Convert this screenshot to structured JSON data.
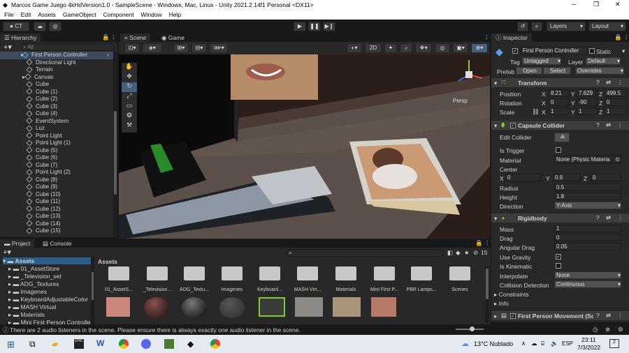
{
  "window": {
    "title": "Marcos Game Juego 4kHdVersion1.0 - SampleScene - Windows, Mac, Linux - Unity 2021.2.14f1 Personal <DX11>",
    "min": "─",
    "max": "❐",
    "close": "✕"
  },
  "menu": [
    "File",
    "Edit",
    "Assets",
    "GameObject",
    "Component",
    "Window",
    "Help"
  ],
  "toolbar": {
    "account": "CT",
    "layers": "Layers",
    "layout": "Layout",
    "play": "▶",
    "pause": "❚❚",
    "step": "▶❙"
  },
  "hierarchy": {
    "tab": "Hierarchy",
    "search_placeholder": "All",
    "items": [
      "First Person Controller",
      "Directional Light",
      "Terrain",
      "Canvas",
      "Cube",
      "Cube (1)",
      "Cube (2)",
      "Cube (3)",
      "Cube (4)",
      "EventSystem",
      "Luz",
      "Point Light",
      "Point Light (1)",
      "Cube (5)",
      "Cube (6)",
      "Cube (7)",
      "Point Light (2)",
      "Cube (8)",
      "Cube (9)",
      "Cube (10)",
      "Cube (11)",
      "Cube (12)",
      "Cube (13)",
      "Cube (14)",
      "Cube (15)"
    ]
  },
  "scene": {
    "tab_scene": "Scene",
    "tab_game": "Game",
    "mode_2d": "2D",
    "persp": "Persp"
  },
  "inspector": {
    "tab": "Inspector",
    "object_name": "First Person Controller",
    "static": "Static",
    "tag_label": "Tag",
    "tag": "Untagged",
    "layer_label": "Layer",
    "layer": "Default",
    "prefab_label": "Prefab",
    "open": "Open",
    "select": "Select",
    "overrides": "Overrides",
    "transform": {
      "title": "Transform",
      "position": {
        "label": "Position",
        "x": "8.21",
        "y": "7.629",
        "z": "499.5"
      },
      "rotation": {
        "label": "Rotation",
        "x": "0",
        "y": "-90",
        "z": "0"
      },
      "scale": {
        "label": "Scale",
        "x": "1",
        "y": "1",
        "z": "1"
      }
    },
    "capsule": {
      "title": "Capsule Collider",
      "edit": "Edit Collider",
      "trigger": "Is Trigger",
      "material": "Material",
      "material_val": "None (Physic Materia",
      "center": "Center",
      "cx": "0",
      "cy": "0.9",
      "cz": "0",
      "radius": "Radius",
      "radius_val": "0.5",
      "height": "Height",
      "height_val": "1.8",
      "direction": "Direction",
      "direction_val": "Y-Axis"
    },
    "rigidbody": {
      "title": "Rigidbody",
      "mass": "Mass",
      "mass_val": "1",
      "drag": "Drag",
      "drag_val": "0",
      "adrag": "Angular Drag",
      "adrag_val": "0.05",
      "gravity": "Use Gravity",
      "kinematic": "Is Kinematic",
      "interpolate": "Interpolate",
      "interpolate_val": "None",
      "collision": "Collision Detection",
      "collision_val": "Continuous",
      "constraints": "Constraints",
      "info": "Info"
    },
    "movement": "First Person Movement (Scr"
  },
  "project": {
    "tab_project": "Project",
    "tab_console": "Console",
    "root": "Assets",
    "tree": [
      "01_AssetStore",
      "_Television_set",
      "ADG_Textures",
      "Imagenes",
      "KeyboardAdjustableColor",
      "MASH Virtual",
      "Materials",
      "Mini First Person Controlle"
    ],
    "breadcrumb": "Assets",
    "count": "15",
    "assets": [
      "01_AssetS...",
      "_Television...",
      "ADG_Textu...",
      "Imagenes",
      "Keyboard...",
      "MASH Virt...",
      "Materials",
      "Mini First P...",
      "PBR Lamps...",
      "Scenes"
    ]
  },
  "status": "There are 2 audio listeners in the scene. Please ensure there is always exactly one audio listener in the scene.",
  "taskbar": {
    "weather": "13°C  Nublado",
    "lang": "ESP",
    "time": "23:11",
    "date": "7/3/2022",
    "notif": "2"
  }
}
